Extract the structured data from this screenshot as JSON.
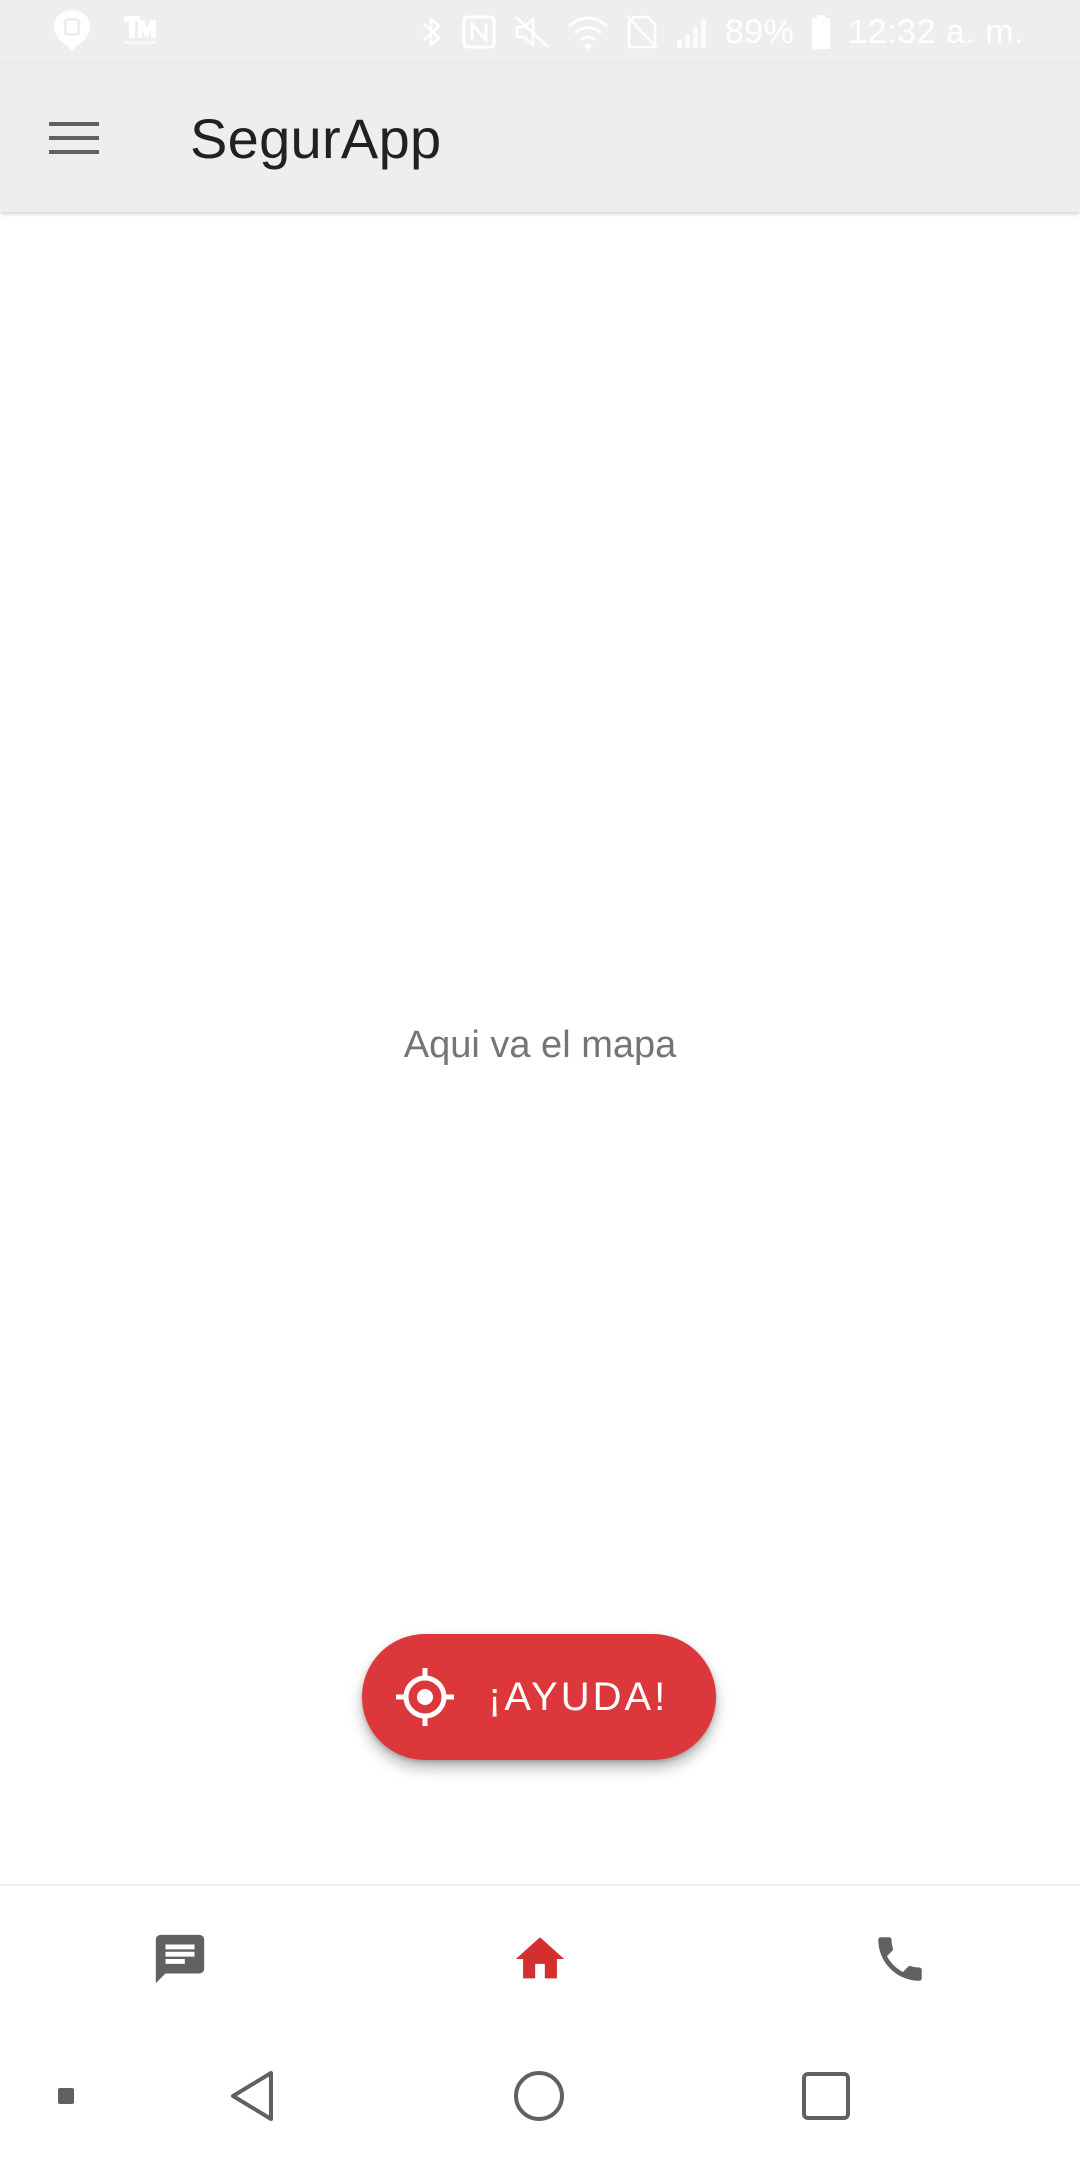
{
  "status_bar": {
    "battery_text": "89%",
    "time": "12:32 a. m.",
    "icons": [
      "notification-app-icon",
      "notification-tm-icon",
      "bluetooth-icon",
      "nfc-icon",
      "mute-icon",
      "wifi-icon",
      "no-sim-icon",
      "signal-icon",
      "battery-icon"
    ]
  },
  "app_bar": {
    "title": "SegurApp",
    "menu_icon": "hamburger-menu-icon"
  },
  "main": {
    "map_placeholder": "Aqui va el mapa"
  },
  "help_button": {
    "label": "¡AYUDA!",
    "icon": "gps-target-icon",
    "color": "#dc373a"
  },
  "bottom_nav": {
    "active": "home",
    "items": [
      {
        "id": "messages",
        "icon": "chat-message-icon"
      },
      {
        "id": "home",
        "icon": "home-icon"
      },
      {
        "id": "phone",
        "icon": "phone-icon"
      }
    ],
    "active_color": "#d32f2f",
    "inactive_color": "#616161"
  },
  "system_nav": {
    "buttons": [
      "dot-icon",
      "back-icon",
      "home-circle-icon",
      "recents-icon"
    ]
  }
}
